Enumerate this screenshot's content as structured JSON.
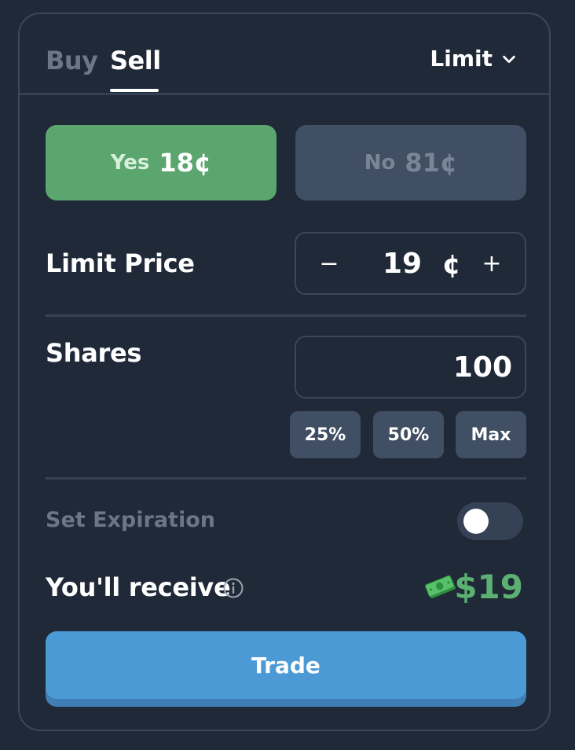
{
  "tabs": [
    {
      "label": "Buy",
      "active": false
    },
    {
      "label": "Sell",
      "active": true
    }
  ],
  "order_type": {
    "label": "Limit",
    "icon": "chevron-down-icon"
  },
  "outcomes": {
    "yes": {
      "label": "Yes",
      "price": "18¢",
      "selected": true,
      "color": "#5ba66e"
    },
    "no": {
      "label": "No",
      "price": "81¢",
      "selected": false,
      "color": "#404f63"
    }
  },
  "limit_price": {
    "label": "Limit Price",
    "value": "19",
    "unit": "¢",
    "decrement_label": "−",
    "increment_label": "+"
  },
  "shares": {
    "label": "Shares",
    "value": "100",
    "quick_buttons": [
      "25%",
      "50%",
      "Max"
    ]
  },
  "expiration": {
    "label": "Set Expiration",
    "enabled": false
  },
  "receive": {
    "label": "You'll receive",
    "amount": "$19",
    "info_icon": "info-icon",
    "money_icon": "money-icon",
    "amount_color": "#5bb072"
  },
  "trade": {
    "label": "Trade",
    "color": "#4b9ad6"
  },
  "colors": {
    "background": "#1f2937",
    "border": "#3c4859",
    "muted_text": "#6b7785",
    "secondary_button": "#404f63"
  }
}
